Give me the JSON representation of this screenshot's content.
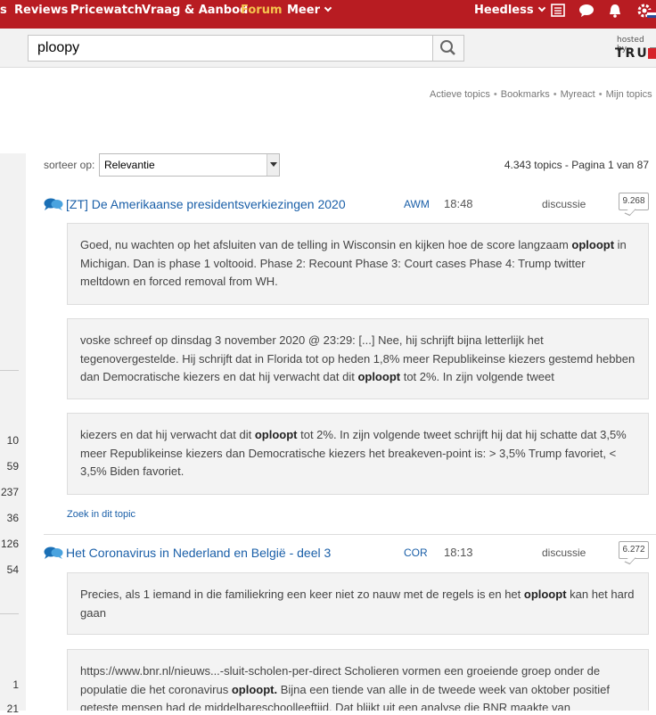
{
  "nav": {
    "items": [
      "s",
      "Reviews",
      "Pricewatch",
      "Vraag & Aanbod",
      "Forum",
      "Meer"
    ],
    "user": "Heedless",
    "colors": {
      "bar": "#b81c22",
      "active": "#f5c44e"
    }
  },
  "search": {
    "value": "ploopy",
    "hosted_by": "hosted by",
    "logo": "TRUE"
  },
  "sublinks": [
    "Actieve topics",
    "Bookmarks",
    "Myreact",
    "Mijn topics"
  ],
  "gutter_numbers": [
    "10",
    "59",
    "237",
    "36",
    "126",
    "54",
    "1",
    "21"
  ],
  "sort": {
    "label": "sorteer op:",
    "selected": "Relevantie",
    "results": "4.343 topics - Pagina 1 van 87"
  },
  "topics": [
    {
      "title": "[ZT] De Amerikaanse presidentsverkiezingen 2020",
      "author": "AWM",
      "time": "18:48",
      "type": "discussie",
      "count": "9.268",
      "snippets": [
        [
          "Goed, nu wachten op het afsluiten van de telling in Wisconsin en kijken hoe de score langzaam ",
          "oploopt",
          " in Michigan. Dan is phase 1 voltooid. Phase 2: Recount Phase 3: Court cases Phase 4: Trump twitter meltdown en forced removal from WH."
        ],
        [
          "voske schreef op dinsdag 3 november 2020 @ 23:29: [...] Nee, hij schrijft bijna letterlijk het tegenovergestelde. Hij schrijft dat in Florida tot op heden 1,8% meer Republikeinse kiezers gestemd hebben dan Democratische kiezers en dat hij verwacht dat dit ",
          "oploopt",
          " tot 2%. In zijn volgende tweet"
        ],
        [
          "kiezers en dat hij verwacht dat dit ",
          "oploopt",
          " tot 2%. In zijn volgende tweet schrijft hij dat hij schatte dat 3,5% meer Republikeinse kiezers dan Democratische kiezers het breakeven-point is: > 3,5% Trump favoriet, < 3,5% Biden favoriet."
        ]
      ],
      "search_link": "Zoek in dit topic"
    },
    {
      "title": "Het Coronavirus in Nederland en België - deel 3",
      "author": "COR",
      "time": "18:13",
      "type": "discussie",
      "count": "6.272",
      "snippets": [
        [
          "Precies, als 1 iemand in die familiekring een keer niet zo nauw met de regels is en het ",
          "oploopt",
          " kan het hard gaan"
        ],
        [
          "https://www.bnr.nl/nieuws...-sluit-scholen-per-direct Scholieren vormen een groeiende groep onder de populatie die het coronavirus ",
          "oploopt.",
          " Bijna een tiende van alle in de tweede week van oktober positief geteste mensen had de middelbareschoolleeftijd. Dat blijkt uit een analyse die BNR maakte van"
        ]
      ]
    }
  ]
}
